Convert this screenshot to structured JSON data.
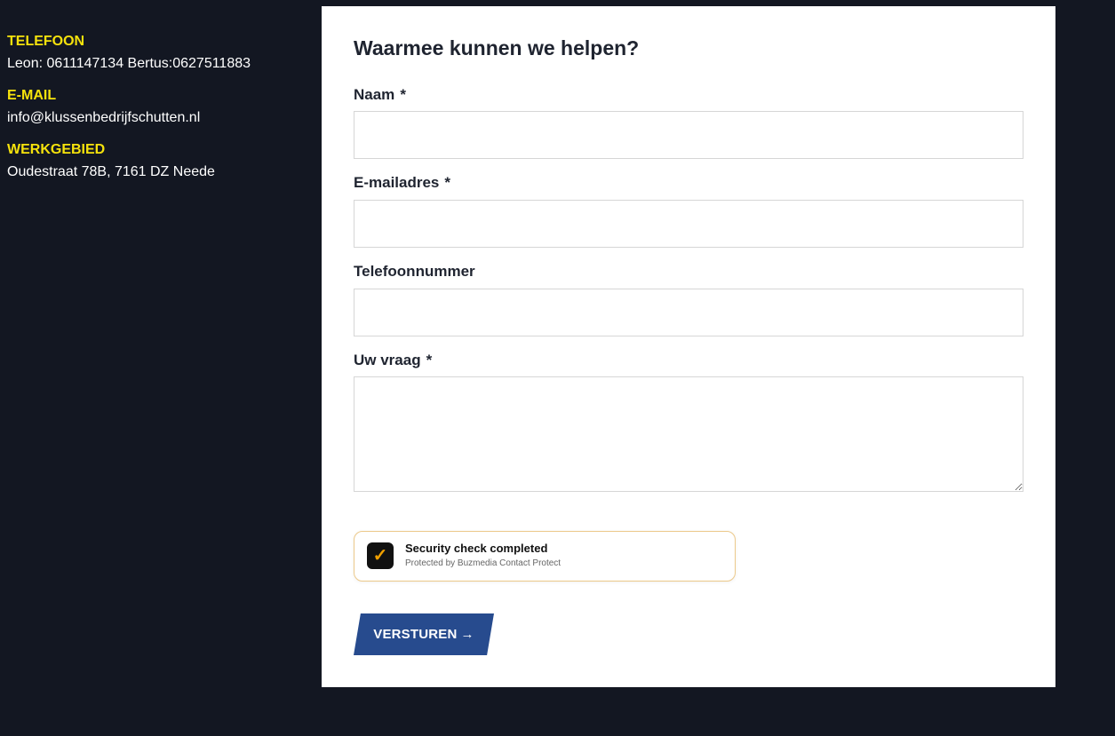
{
  "contact": {
    "phone": {
      "heading": "TELEFOON",
      "value": "Leon: 0611147134 Bertus:0627511883"
    },
    "email": {
      "heading": "E-MAIL",
      "value": "info@klussenbedrijfschutten.nl"
    },
    "area": {
      "heading": "WERKGEBIED",
      "value": "Oudestraat 78B, 7161 DZ Neede"
    }
  },
  "form": {
    "title": "Waarmee kunnen we helpen?",
    "fields": {
      "name": {
        "label": "Naam",
        "required_mark": "*",
        "value": ""
      },
      "email": {
        "label": "E-mailadres",
        "required_mark": "*",
        "value": ""
      },
      "phone": {
        "label": "Telefoonnummer",
        "value": ""
      },
      "question": {
        "label": "Uw vraag",
        "required_mark": "*",
        "value": ""
      }
    },
    "security": {
      "status": "Security check completed",
      "subtext": "Protected by Buzmedia Contact Protect",
      "check_glyph": "✓"
    },
    "submit": {
      "label": "VERSTUREN",
      "arrow": "→"
    }
  },
  "colors": {
    "background": "#131722",
    "heading_accent": "#f5e20c",
    "button": "#274b8e",
    "check_accent": "#f0a000"
  }
}
